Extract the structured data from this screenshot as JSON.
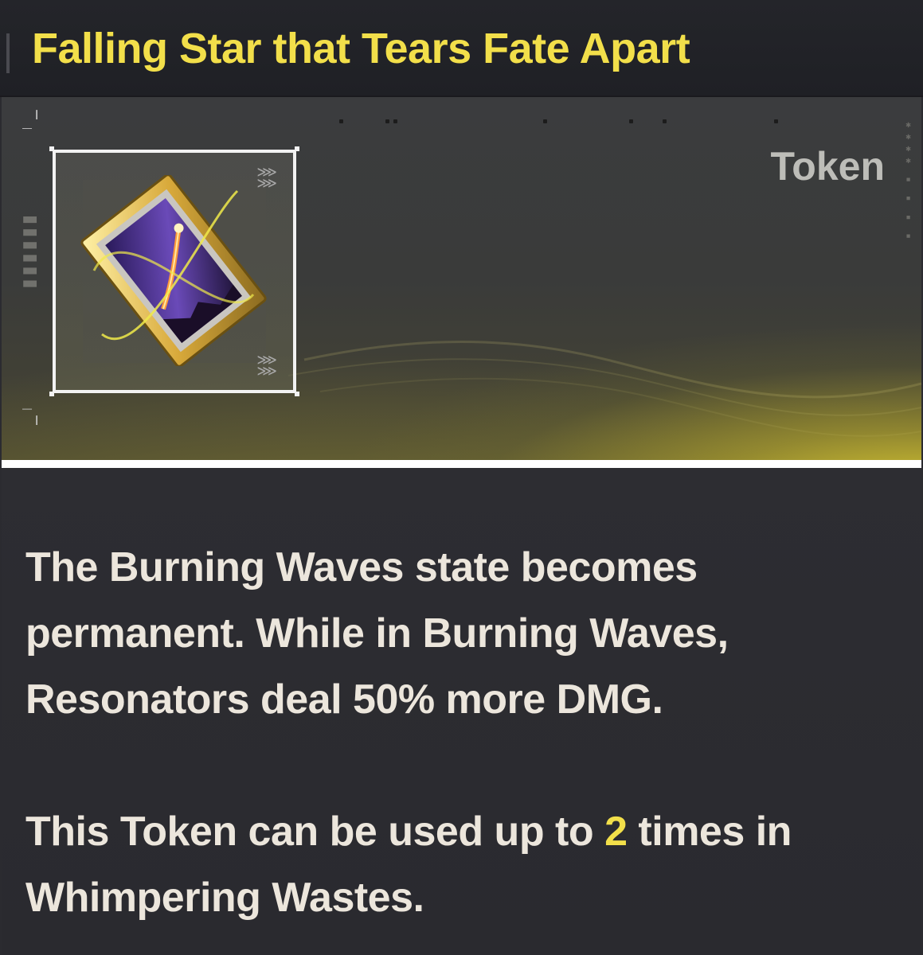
{
  "item": {
    "title": "Falling Star that Tears Fate Apart",
    "category": "Token",
    "icon": "framed-falling-star-painting-icon"
  },
  "description": {
    "paragraph1": "The Burning Waves state becomes permanent. While in Burning Waves, Resonators deal 50% more DMG.",
    "paragraph2_before": "This Token can be used up to ",
    "paragraph2_highlight": "2",
    "paragraph2_after": " times in Whimpering Wastes."
  },
  "colors": {
    "title": "#f2df4a",
    "highlight": "#f2df4a",
    "text": "#ece6dc",
    "background": "#2b2b30",
    "hero_glow": "#e4d232"
  }
}
